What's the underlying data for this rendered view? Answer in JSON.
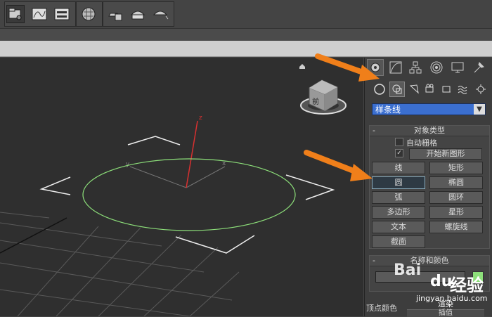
{
  "toolbar": {
    "buttons": [
      "layer-manager-icon",
      "curve-editor-icon",
      "schematic-view-icon",
      "material-editor-icon",
      "render-setup-icon",
      "render-frame-icon",
      "render-icon"
    ]
  },
  "viewport": {
    "axis_x": "x",
    "axis_y": "y",
    "axis_z": "z",
    "viewcube_face": "前"
  },
  "command_panel": {
    "dropdown_value": "样条线",
    "rollout_object_type": {
      "title": "对象类型",
      "minus": "-",
      "autogrid_label": "自动栅格",
      "start_new_shape_label": "开始新图形",
      "start_new_shape_checked": "✓",
      "buttons": [
        "线",
        "矩形",
        "圆",
        "椭圆",
        "弧",
        "圆环",
        "多边形",
        "星形",
        "文本",
        "螺旋线",
        "截面"
      ]
    },
    "rollout_name_color": {
      "title": "名称和颜色",
      "minus": "-"
    },
    "bottom_fragments": {
      "left": "顶点颜色",
      "right": "渲染",
      "bottom": "插值"
    }
  },
  "watermark": {
    "brand": "Bai",
    "logo": "du",
    "text": "经验",
    "url": "jingyan.baidu.com"
  },
  "colors": {
    "accent_arrow": "#f07f1a",
    "selection_dropdown": "#3b6fd0",
    "spline_color": "#8de07a"
  }
}
